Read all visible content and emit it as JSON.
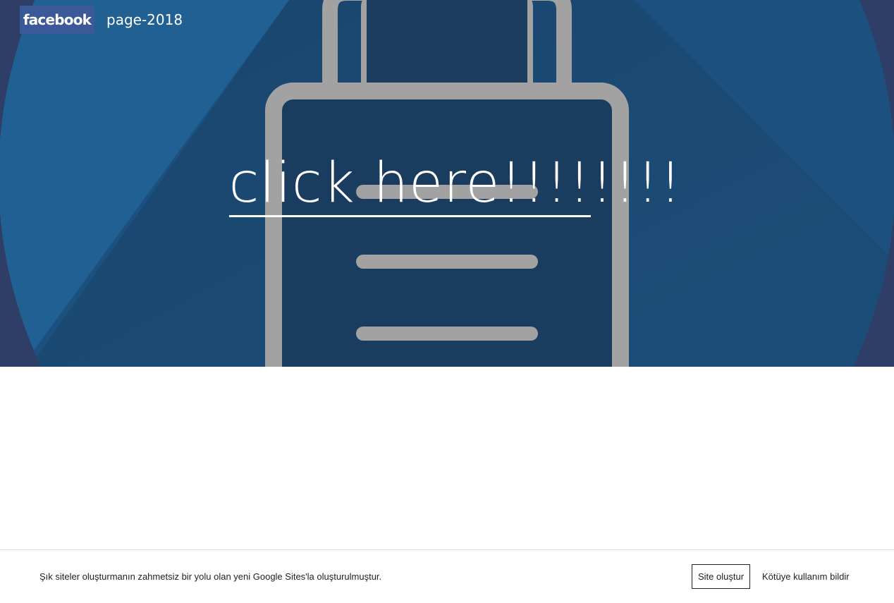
{
  "header": {
    "logo_text": "facebook",
    "site_title": "page-2018"
  },
  "hero": {
    "link_underlined": "click here!!!!",
    "link_rest": "!!!!",
    "background_icon": "lock-icon"
  },
  "footer": {
    "text": "Şık siteler oluşturmanın zahmetsiz bir yolu olan yeni Google Sites'la oluşturulmuştur.",
    "create_site_label": "Site oluştur",
    "report_abuse_label": "Kötüye kullanım bildir"
  },
  "colors": {
    "hero_dark": "#2f3e66",
    "circle_blue": "#216093",
    "lock_gray": "#a2a2a2",
    "facebook_blue": "#3b5998"
  }
}
